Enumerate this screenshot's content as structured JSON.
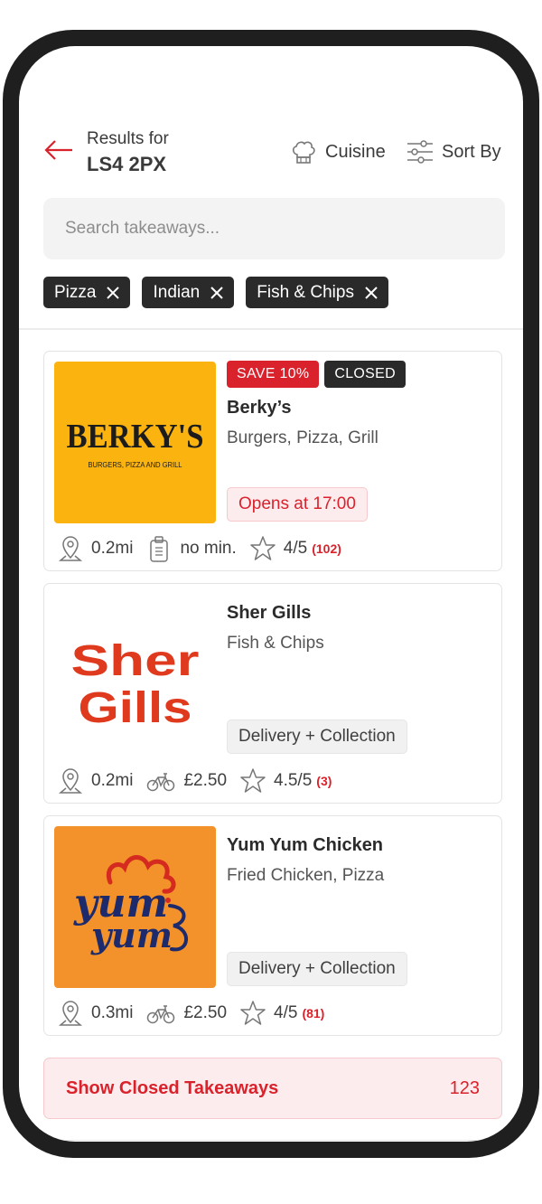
{
  "header": {
    "results_label": "Results for",
    "postcode": "LS4 2PX",
    "cuisine_label": "Cuisine",
    "sort_label": "Sort By"
  },
  "search": {
    "placeholder": "Search takeaways..."
  },
  "filters": [
    "Pizza",
    "Indian",
    "Fish & Chips"
  ],
  "colors": {
    "accent": "#d9222c",
    "chip_bg": "#2a2a2a",
    "frame": "#1f1f1f"
  },
  "restaurants": [
    {
      "name": "Berky’s",
      "cuisine": "Burgers, Pizza, Grill",
      "badges": [
        "SAVE 10%",
        "CLOSED"
      ],
      "status_pill": "Opens at 17:00",
      "logo_text": "BERKY'S",
      "logo_subtext": "BURGERS, PIZZA AND GRILL",
      "distance": "0.2mi",
      "min_order": "no min.",
      "rating": "4/5",
      "rating_count": "(102)"
    },
    {
      "name": "Sher Gills",
      "cuisine": "Fish & Chips",
      "status_pill": "Delivery + Collection",
      "logo_text_1": "Sher",
      "logo_text_2": "Gills",
      "distance": "0.2mi",
      "delivery_fee": "£2.50",
      "rating": "4.5/5",
      "rating_count": "(3)"
    },
    {
      "name": "Yum Yum Chicken",
      "cuisine": "Fried Chicken, Pizza",
      "status_pill": "Delivery + Collection",
      "logo_text_1": "yum",
      "logo_text_2": "yum",
      "distance": "0.3mi",
      "delivery_fee": "£2.50",
      "rating": "4/5",
      "rating_count": "(81)"
    }
  ],
  "closed_banner": {
    "label": "Show Closed Takeaways",
    "count": "123"
  }
}
